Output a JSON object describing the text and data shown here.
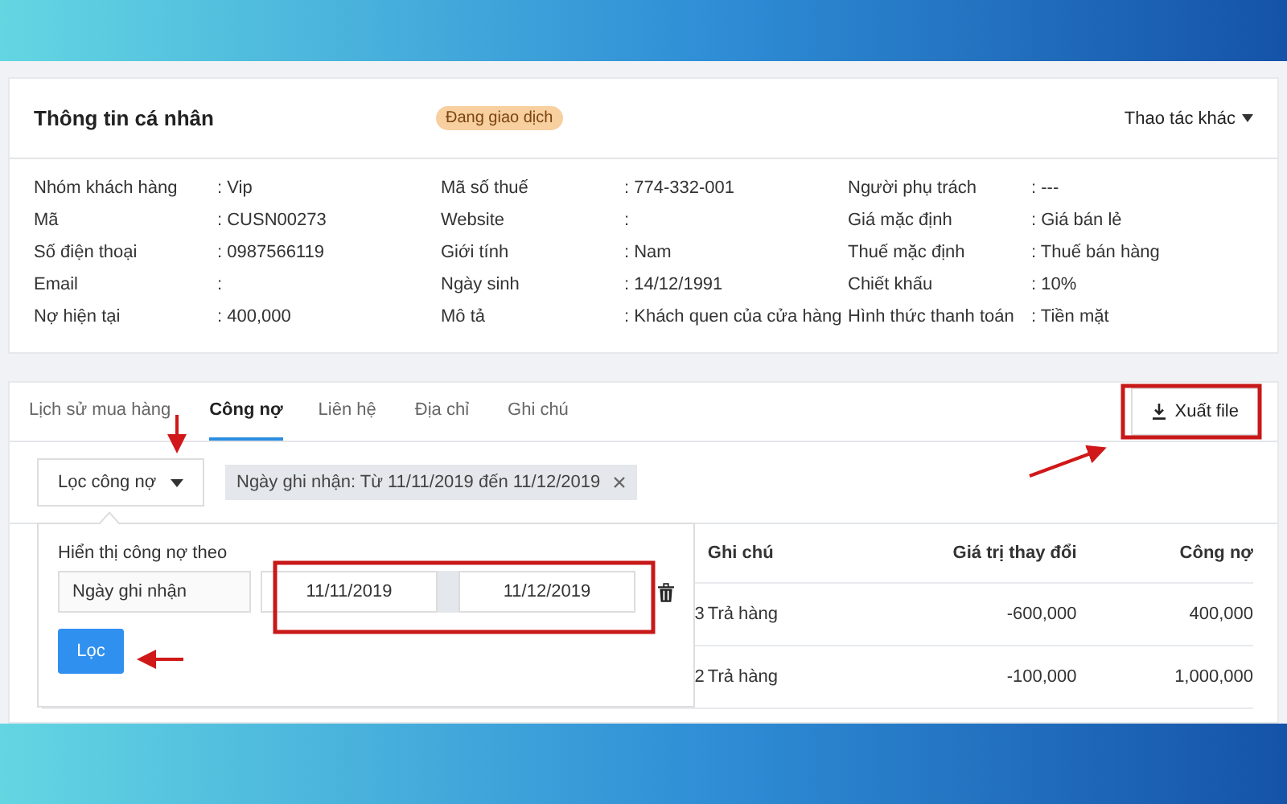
{
  "profile_card": {
    "title": "Thông tin cá nhân",
    "status_badge": "Đang giao dịch",
    "actions_menu": "Thao tác khác",
    "field_columns": [
      [
        {
          "label": "Nhóm khách hàng",
          "value": ": Vip"
        },
        {
          "label": "Mã",
          "value": ": CUSN00273"
        },
        {
          "label": "Số điện thoại",
          "value": ": 0987566119"
        },
        {
          "label": "Email",
          "value": ":"
        },
        {
          "label": "Nợ hiện tại",
          "value": ": 400,000"
        }
      ],
      [
        {
          "label": "Mã số thuế",
          "value": ": 774-332-001"
        },
        {
          "label": "Website",
          "value": ":"
        },
        {
          "label": "Giới tính",
          "value": ": Nam"
        },
        {
          "label": "Ngày sinh",
          "value": ": 14/12/1991"
        },
        {
          "label": "Mô tả",
          "value": ": Khách quen của cửa hàng"
        }
      ],
      [
        {
          "label": "Người phụ trách",
          "value": ": ---"
        },
        {
          "label": "Giá mặc định",
          "value": ": Giá bán lẻ"
        },
        {
          "label": "Thuế mặc định",
          "value": ": Thuế bán hàng"
        },
        {
          "label": "Chiết khấu",
          "value": ": 10%"
        },
        {
          "label": "Hình thức thanh toán",
          "value": ": Tiền mặt"
        }
      ]
    ]
  },
  "tabs": [
    {
      "label": "Lịch sử mua hàng",
      "selected": false
    },
    {
      "label": "Công nợ",
      "selected": true
    },
    {
      "label": "Liên hệ",
      "selected": false
    },
    {
      "label": "Địa chỉ",
      "selected": false
    },
    {
      "label": "Ghi chú",
      "selected": false
    }
  ],
  "export_button": "Xuất file",
  "filter_dropdown": "Lọc công nợ",
  "filter_chip": "Ngày ghi nhận: Từ 11/11/2019 đến 11/12/2019",
  "filter_popover": {
    "title": "Hiển thị công nợ theo",
    "field": "Ngày ghi nhận",
    "date_from": "11/11/2019",
    "date_to": "11/12/2019",
    "apply_button": "Lọc"
  },
  "table": {
    "columns": [
      "Ghi chú",
      "Giá trị thay đổi",
      "Công nợ"
    ],
    "rows": [
      {
        "column_1": "3",
        "cells": [
          "Trả hàng",
          "-600,000",
          "400,000"
        ]
      },
      {
        "column_1": "2",
        "cells": [
          "Trả hàng",
          "-100,000",
          "1,000,000"
        ]
      }
    ]
  }
}
